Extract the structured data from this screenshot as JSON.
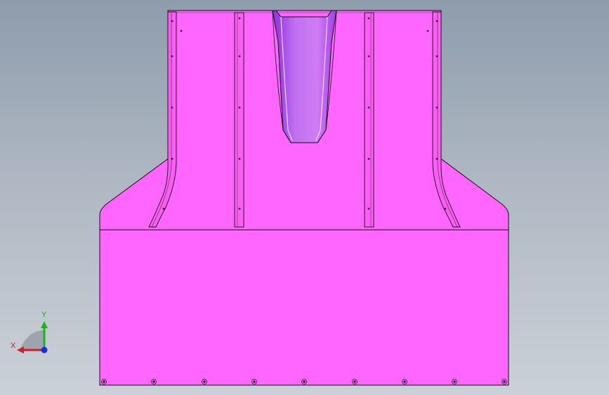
{
  "viewport": {
    "background_top": "#8e9cac",
    "background_bottom": "#cbd1d8"
  },
  "model": {
    "body_color": "#ff66ff",
    "edge_color": "#111111",
    "channel_color": "#b44ee6"
  },
  "triad": {
    "x_label": "X",
    "y_label": "Y",
    "x_color": "#d01e2a",
    "y_color": "#22b022",
    "z_color": "#1a2ee0"
  }
}
